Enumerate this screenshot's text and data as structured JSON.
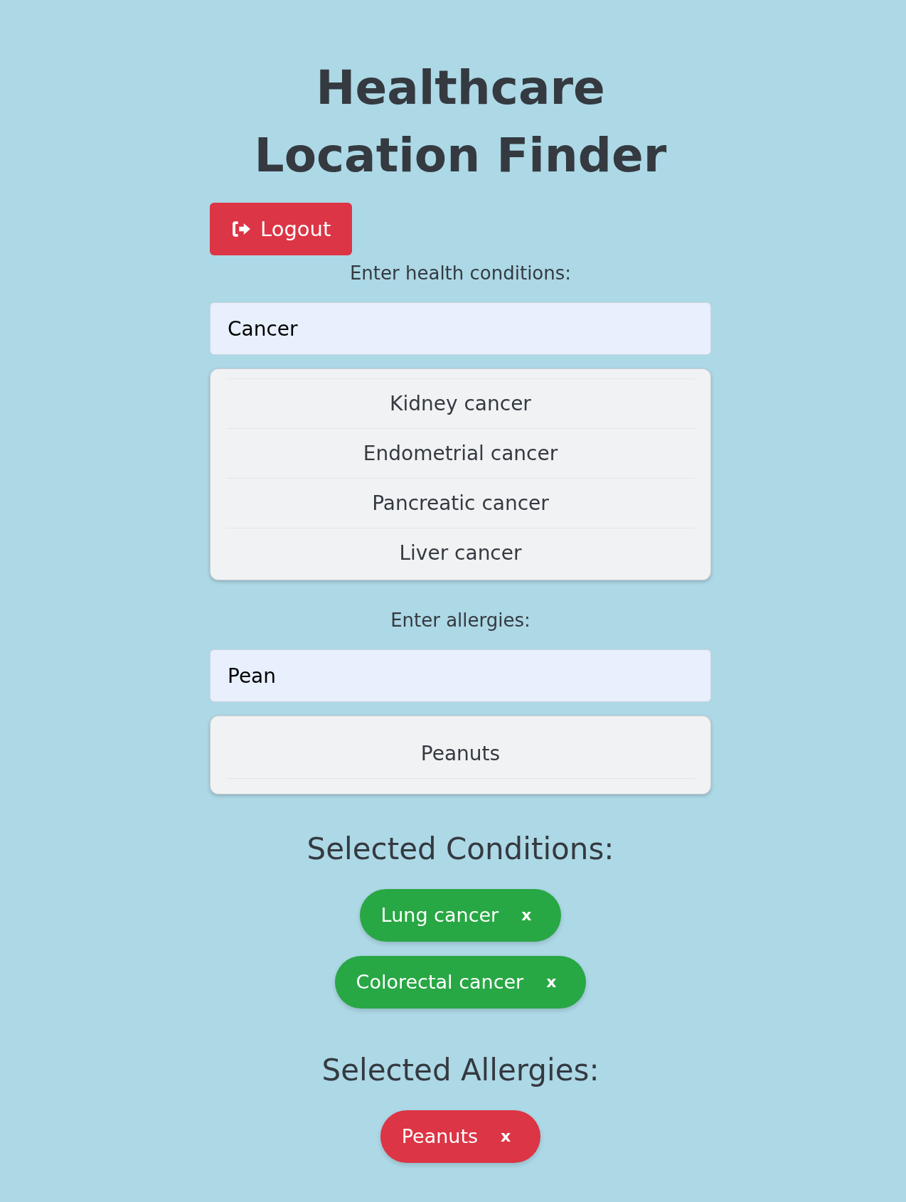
{
  "title": "Healthcare Location Finder",
  "logout_button": {
    "label": "Logout"
  },
  "conditions": {
    "label": "Enter health conditions:",
    "input": {
      "value": "Cancer"
    },
    "suggestions": {
      "scrolled": true,
      "items": [
        "Kidney cancer",
        "Endometrial cancer",
        "Pancreatic cancer",
        "Liver cancer"
      ]
    }
  },
  "allergies": {
    "label": "Enter allergies:",
    "input": {
      "value": "Pean"
    },
    "suggestions": {
      "scrolled": false,
      "items": [
        "Peanuts"
      ]
    }
  },
  "selected_conditions": {
    "heading": "Selected Conditions:",
    "chips": [
      {
        "label": "Lung cancer",
        "remove": "x"
      },
      {
        "label": "Colorectal cancer",
        "remove": "x"
      }
    ]
  },
  "selected_allergies": {
    "heading": "Selected Allergies:",
    "chips": [
      {
        "label": "Peanuts",
        "remove": "x"
      }
    ]
  }
}
